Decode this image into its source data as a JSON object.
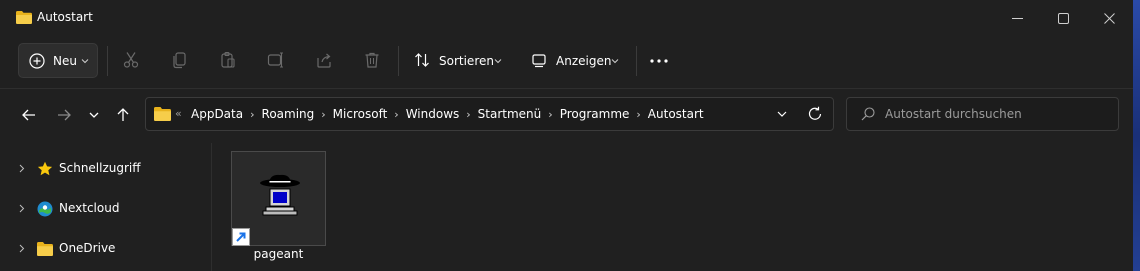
{
  "window": {
    "title": "Autostart"
  },
  "toolbar": {
    "new_label": "Neu",
    "sort_label": "Sortieren",
    "view_label": "Anzeigen",
    "disabled_icons": [
      "cut-icon",
      "copy-icon",
      "paste-icon",
      "rename-icon",
      "share-icon",
      "delete-icon"
    ]
  },
  "address": {
    "overflow": "«",
    "crumbs": [
      "AppData",
      "Roaming",
      "Microsoft",
      "Windows",
      "Startmenü",
      "Programme",
      "Autostart"
    ],
    "separator": "›"
  },
  "search": {
    "placeholder": "Autostart durchsuchen",
    "value": ""
  },
  "sidebar": {
    "items": [
      {
        "label": "Schnellzugriff",
        "icon": "star-icon"
      },
      {
        "label": "Nextcloud",
        "icon": "nextcloud-icon"
      },
      {
        "label": "OneDrive",
        "icon": "folder-icon"
      }
    ]
  },
  "files": [
    {
      "name": "pageant",
      "icon": "pageant-icon",
      "shortcut": true
    }
  ],
  "colors": {
    "window_bg": "#202020",
    "folder": "#f4c430",
    "star": "#f9c80e",
    "accent": "#0078d4"
  }
}
